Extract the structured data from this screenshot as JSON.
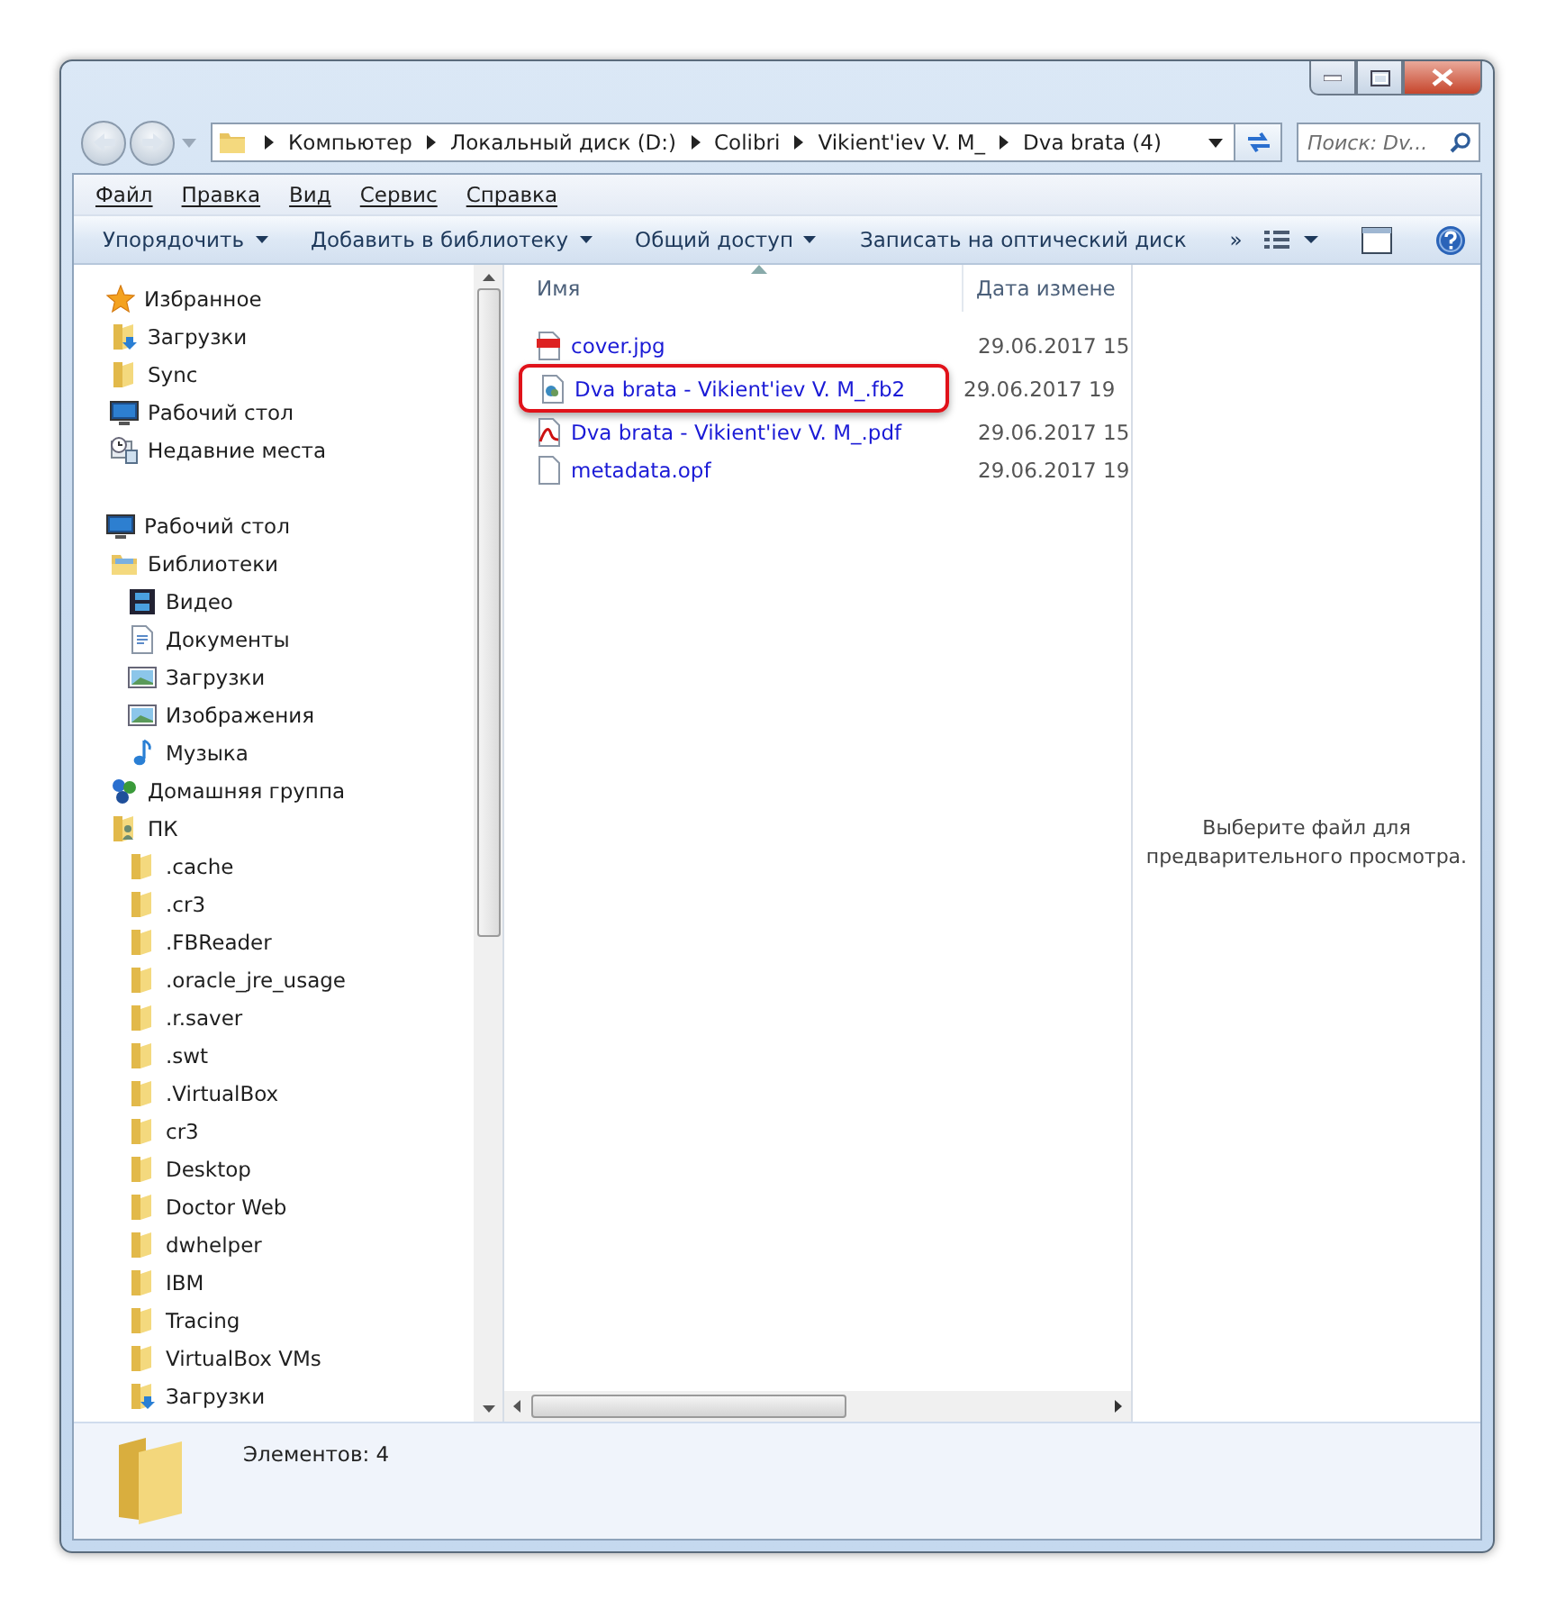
{
  "address_bar": {
    "crumbs": [
      "Компьютер",
      "Локальный диск (D:)",
      "Colibri",
      "Vikient'iev V. M_",
      "Dva brata (4)"
    ]
  },
  "search": {
    "placeholder": "Поиск: Dv..."
  },
  "menu": [
    "Файл",
    "Правка",
    "Вид",
    "Сервис",
    "Справка"
  ],
  "toolbar": [
    "Упорядочить",
    "Добавить в библиотеку",
    "Общий доступ",
    "Записать на оптический диск"
  ],
  "overflow": "»",
  "sidebar": {
    "groups": [
      {
        "label": "Избранное",
        "kind": "star",
        "children": [
          {
            "label": "Загрузки",
            "kind": "downloads"
          },
          {
            "label": "Sync",
            "kind": "folder"
          },
          {
            "label": "Рабочий стол",
            "kind": "desktop"
          },
          {
            "label": "Недавние места",
            "kind": "recent"
          }
        ]
      },
      {
        "label": "Рабочий стол",
        "kind": "desktop",
        "children": [
          {
            "label": "Библиотеки",
            "kind": "libraries",
            "children": [
              {
                "label": "Видео",
                "kind": "video"
              },
              {
                "label": "Документы",
                "kind": "documents"
              },
              {
                "label": "Загрузки",
                "kind": "library"
              },
              {
                "label": "Изображения",
                "kind": "pictures"
              },
              {
                "label": "Музыка",
                "kind": "music"
              }
            ]
          },
          {
            "label": "Домашняя группа",
            "kind": "homegroup"
          },
          {
            "label": "ПК",
            "kind": "user",
            "children": [
              {
                "label": ".cache",
                "kind": "folder"
              },
              {
                "label": ".cr3",
                "kind": "folder"
              },
              {
                "label": ".FBReader",
                "kind": "folder"
              },
              {
                "label": ".oracle_jre_usage",
                "kind": "folder"
              },
              {
                "label": ".r.saver",
                "kind": "folder"
              },
              {
                "label": ".swt",
                "kind": "folder"
              },
              {
                "label": ".VirtualBox",
                "kind": "folder"
              },
              {
                "label": "cr3",
                "kind": "folder"
              },
              {
                "label": "Desktop",
                "kind": "folder"
              },
              {
                "label": "Doctor Web",
                "kind": "folder"
              },
              {
                "label": "dwhelper",
                "kind": "folder"
              },
              {
                "label": "IBM",
                "kind": "folder"
              },
              {
                "label": "Tracing",
                "kind": "folder"
              },
              {
                "label": "VirtualBox VMs",
                "kind": "folder"
              },
              {
                "label": "Загрузки",
                "kind": "downloads"
              }
            ]
          }
        ]
      }
    ]
  },
  "columns": [
    "Имя",
    "Дата измене"
  ],
  "files": [
    {
      "name": "cover.jpg",
      "date": "29.06.2017 15",
      "kind": "jpg",
      "highlighted": false
    },
    {
      "name": "Dva brata - Vikient'iev V. M_.fb2",
      "date": "29.06.2017 19",
      "kind": "fb2",
      "highlighted": true
    },
    {
      "name": "Dva brata - Vikient'iev V. M_.pdf",
      "date": "29.06.2017 15",
      "kind": "pdf",
      "highlighted": false
    },
    {
      "name": "metadata.opf",
      "date": "29.06.2017 19",
      "kind": "file",
      "highlighted": false
    }
  ],
  "preview_message": "Выберите файл для предварительного просмотра.",
  "status": "Элементов: 4"
}
